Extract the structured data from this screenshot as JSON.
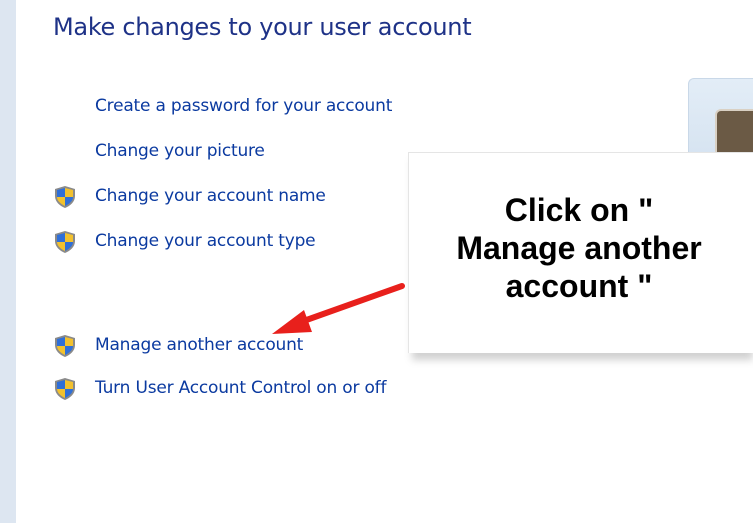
{
  "window": {
    "heading": "Make changes to your user account"
  },
  "links": {
    "create_password": "Create a password for your account",
    "change_picture": "Change your picture",
    "change_name": "Change your account name",
    "change_type": "Change your account type",
    "manage_another": "Manage another account",
    "uac": "Turn User Account Control on or off"
  },
  "callout": {
    "text": "Click on \"\nManage another\naccount \""
  },
  "icons": {
    "shield": "uac-shield-icon",
    "arrow": "red-arrow-icon",
    "avatar": "user-picture-icon"
  },
  "colors": {
    "link": "#0b3aa0",
    "heading": "#1e3287",
    "arrow": "#e8201c",
    "background": "#dde6f1"
  }
}
